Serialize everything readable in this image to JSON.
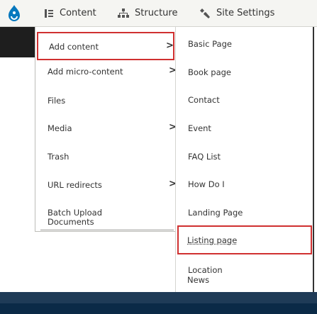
{
  "toolbar": {
    "logo_icon": "drupal-drop-icon",
    "content_label": "Content",
    "structure_label": "Structure",
    "settings_label": "Site Settings"
  },
  "left_menu": {
    "items": [
      {
        "label": "Add content",
        "arrow": ">"
      },
      {
        "label": "Add micro-content",
        "arrow": ">"
      },
      {
        "label": "Files",
        "arrow": ""
      },
      {
        "label": "Media",
        "arrow": ">"
      },
      {
        "label": "Trash",
        "arrow": ""
      },
      {
        "label": "URL redirects",
        "arrow": ">"
      },
      {
        "label": "Batch Upload",
        "arrow": ""
      },
      {
        "label": "Documents",
        "arrow": ""
      }
    ]
  },
  "right_menu": {
    "items": [
      "Basic Page",
      "Book page",
      "Contact",
      "Event",
      "FAQ List",
      "How Do I",
      "Landing Page",
      "Listing page",
      "Location",
      "News"
    ]
  },
  "colors": {
    "highlight": "#d03030",
    "brand": "#0678be",
    "toolbar_bg": "#f5f5f2"
  }
}
